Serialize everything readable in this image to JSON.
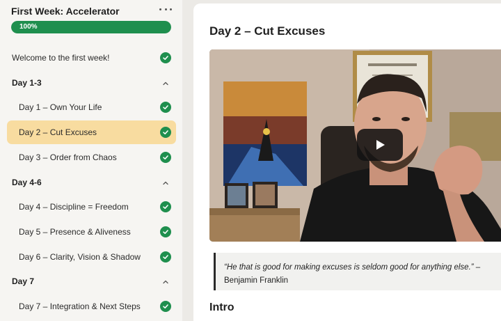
{
  "sidebar": {
    "course_title": "First Week: Accelerator",
    "progress_label": "100%",
    "progress_value": 1.0,
    "items": [
      {
        "label": "Welcome to the first week!",
        "kind": "top",
        "completed": true
      },
      {
        "label": "Day 1-3",
        "kind": "section",
        "expanded": true
      },
      {
        "label": "Day 1 – Own Your Life",
        "kind": "lesson",
        "completed": true
      },
      {
        "label": "Day 2 – Cut Excuses",
        "kind": "lesson",
        "completed": true,
        "active": true
      },
      {
        "label": "Day 3 – Order from Chaos",
        "kind": "lesson",
        "completed": true
      },
      {
        "label": "Day 4-6",
        "kind": "section",
        "expanded": true
      },
      {
        "label": "Day 4 – Discipline = Freedom",
        "kind": "lesson",
        "completed": true
      },
      {
        "label": "Day 5 – Presence & Aliveness",
        "kind": "lesson",
        "completed": true
      },
      {
        "label": "Day 6 – Clarity, Vision & Shadow",
        "kind": "lesson",
        "completed": true
      },
      {
        "label": "Day 7",
        "kind": "section",
        "expanded": true
      },
      {
        "label": "Day 7 – Integration & Next Steps",
        "kind": "lesson",
        "completed": true
      }
    ]
  },
  "main": {
    "lesson_title": "Day 2 – Cut Excuses",
    "quote_text": "“He that is good for making excuses is seldom good for anything else.”",
    "quote_attribution": " – Benjamin Franklin",
    "section_heading": "Intro"
  },
  "colors": {
    "accent_green": "#1f8f4e",
    "active_highlight": "#f8dca0"
  },
  "icons": {
    "more": "more-horizontal-icon",
    "check": "check-circle-icon",
    "chevron": "chevron-up-icon",
    "play": "play-icon"
  }
}
